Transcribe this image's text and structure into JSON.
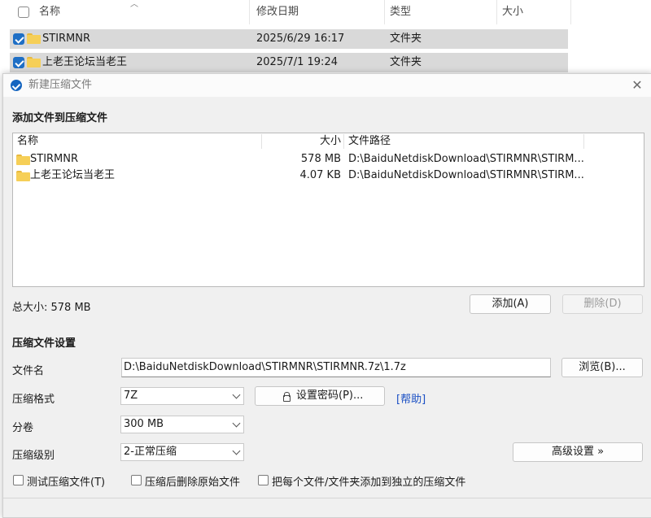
{
  "explorer": {
    "columns": {
      "name": "名称",
      "modified": "修改日期",
      "type": "类型",
      "size": "大小"
    },
    "rows": [
      {
        "name": "STIRMNR",
        "modified": "2025/6/29 16:17",
        "type": "文件夹",
        "checked": true
      },
      {
        "name": "上老王论坛当老王",
        "modified": "2025/7/1 19:24",
        "type": "文件夹",
        "checked": true
      }
    ]
  },
  "dialog": {
    "title": "新建压缩文件",
    "add_section_title": "添加文件到压缩文件",
    "list": {
      "headers": {
        "name": "名称",
        "size": "大小",
        "path": "文件路径"
      },
      "items": [
        {
          "name": "STIRMNR",
          "size": "578 MB",
          "path": "D:\\BaiduNetdiskDownload\\STIRMNR\\STIRM..."
        },
        {
          "name": "上老王论坛当老王",
          "size": "4.07 KB",
          "path": "D:\\BaiduNetdiskDownload\\STIRMNR\\STIRM..."
        }
      ]
    },
    "total_size": "总大小: 578 MB",
    "add_button": "添加(A)",
    "delete_button": "删除(D)",
    "settings_section_title": "压缩文件设置",
    "filename_label": "文件名",
    "filename_value": "D:\\BaiduNetdiskDownload\\STIRMNR\\STIRMNR.7z\\1.7z",
    "browse_button": "浏览(B)...",
    "format_label": "压缩格式",
    "format_value": "7Z",
    "set_password_button": "设置密码(P)...",
    "help_link": "[帮助]",
    "split_label": "分卷",
    "split_value": "300 MB",
    "level_label": "压缩级别",
    "level_value": "2-正常压缩",
    "advanced_button": "高级设置 »",
    "options": {
      "test": "测试压缩文件(T)",
      "delete_after": "压缩后删除原始文件",
      "separate": "把每个文件/文件夹添加到独立的压缩文件"
    }
  }
}
